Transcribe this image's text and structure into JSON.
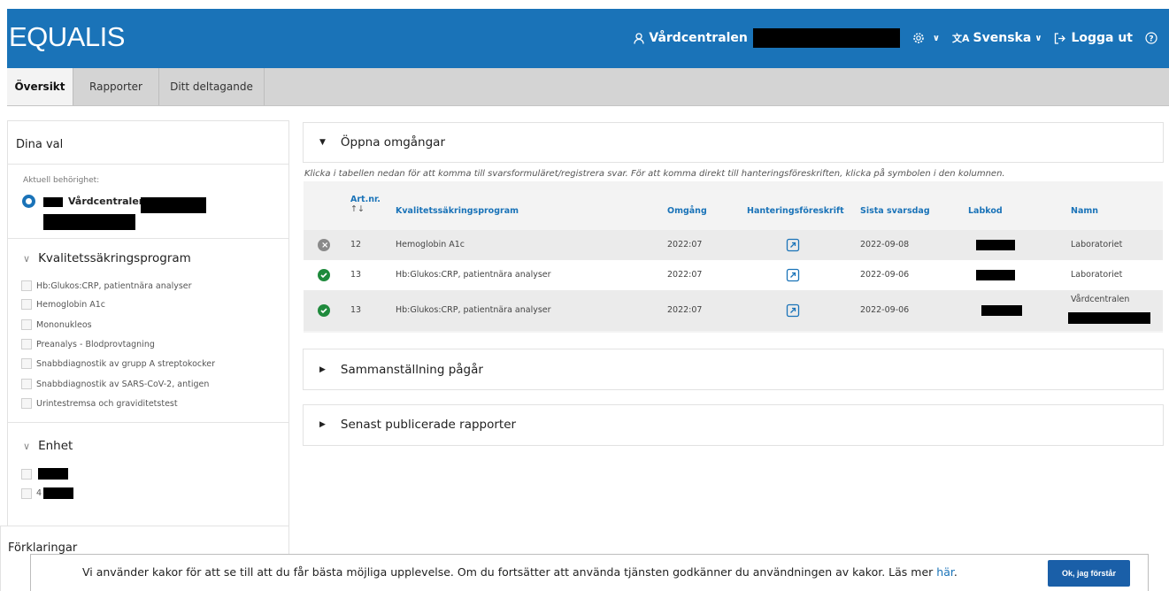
{
  "header": {
    "logo": "EQUALIS",
    "user": "Vårdcentralen",
    "language": "Svenska",
    "logout": "Logga ut",
    "colors": {
      "brand": "#1a73b8"
    }
  },
  "tabs": [
    {
      "label": "Översikt",
      "active": true
    },
    {
      "label": "Rapporter",
      "active": false
    },
    {
      "label": "Ditt deltagande",
      "active": false
    }
  ],
  "sidebar": {
    "title": "Dina val",
    "current_label": "Aktuell behörighet:",
    "current_value": "Vårdcentralen",
    "programs_heading": "Kvalitetssäkringsprogram",
    "programs": [
      "Hb:Glukos:CRP, patientnära analyser",
      "Hemoglobin A1c",
      "Mononukleos",
      "Preanalys - Blodprovtagning",
      "Snabbdiagnostik av grupp A streptokocker",
      "Snabbdiagnostik av SARS-CoV-2, antigen",
      "Urintestremsa och graviditetstest"
    ],
    "unit_heading": "Enhet",
    "units": [
      "",
      "4"
    ],
    "legend_heading": "Förklaringar"
  },
  "open_rounds": {
    "title": "Öppna omgångar",
    "instruction": "Klicka i tabellen nedan för att komma till svarsformuläret/registrera svar. För att komma direkt till hanteringsföreskriften, klicka på symbolen i den kolumnen.",
    "columns": {
      "art_nr": "Art.nr.",
      "sort_icon": "↑↓",
      "program": "Kvalitetssäkringsprogram",
      "round": "Omgång",
      "instructions": "Hanteringsföreskrift",
      "deadline": "Sista svarsdag",
      "labcode": "Labkod",
      "name": "Namn"
    },
    "rows": [
      {
        "status": "closed",
        "art_nr": "12",
        "program": "Hemoglobin A1c",
        "round": "2022:07",
        "deadline": "2022-09-08",
        "name": "Laboratoriet"
      },
      {
        "status": "done",
        "art_nr": "13",
        "program": "Hb:Glukos:CRP, patientnära analyser",
        "round": "2022:07",
        "deadline": "2022-09-06",
        "name": "Laboratoriet"
      },
      {
        "status": "done",
        "art_nr": "13",
        "program": "Hb:Glukos:CRP, patientnära analyser",
        "round": "2022:07",
        "deadline": "2022-09-06",
        "name": "Vårdcentralen"
      }
    ]
  },
  "summary": {
    "title": "Sammanställning pågår"
  },
  "published": {
    "title": "Senast publicerade rapporter"
  },
  "cookie": {
    "text": "Vi använder kakor för att se till att du får bästa möjliga upplevelse. Om du fortsätter att använda tjänsten godkänner du användningen av kakor. Läs mer",
    "link": "här",
    "button": "Ok, jag förstår"
  }
}
